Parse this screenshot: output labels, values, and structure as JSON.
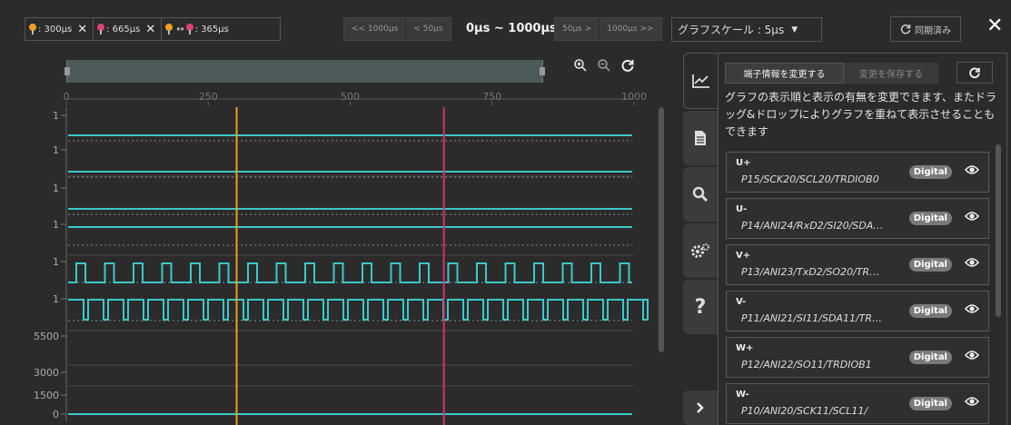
{
  "toolbar": {
    "cursors": [
      {
        "color": "#f0a020",
        "label": ": 300µs",
        "removable": true
      },
      {
        "color": "#e0407a",
        "label": ": 665µs",
        "removable": true
      }
    ],
    "delta": {
      "label": ": 365µs",
      "arrow": "↔"
    },
    "close_cursor_symbol": "✕",
    "nav_left": [
      "<< 1000µs",
      "< 50µs"
    ],
    "range_label": "0µs ~ 1000µs",
    "nav_right": [
      "50µs >",
      "1000µs >>"
    ],
    "scale_label": "グラフスケール : 5µs",
    "scale_caret": "▼",
    "sync_label": "同期済み",
    "close_symbol": "✕"
  },
  "plot": {
    "x_ticks": [
      "0",
      "250",
      "500",
      "750",
      "1000"
    ],
    "y_labels": [
      "1",
      "1",
      "1",
      "1",
      "1",
      "1",
      "5500",
      "3000",
      "1500",
      "0"
    ],
    "cursor_positions_us": [
      300,
      665
    ],
    "x_range_us": [
      0,
      1000
    ],
    "colors": {
      "signal": "#3cc8c8",
      "cursor1": "#e8a020",
      "cursor2": "#d8306a"
    }
  },
  "side_tabs": [
    "chart-icon",
    "document-icon",
    "search-icon",
    "settings-icon",
    "help-icon",
    "chevron-right-icon"
  ],
  "panel": {
    "tab_change": "端子情報を変更する",
    "tab_save": "変更を保存する",
    "description": "グラフの表示順と表示の有無を変更できます、またドラッグ&ドロップによりグラフを重ねて表示させることもできます",
    "pins": [
      {
        "name": "U+",
        "func": "P15/SCK20/SCL20/TRDIOB0",
        "badge": "Digital"
      },
      {
        "name": "U-",
        "func": "P14/ANI24/RxD2/SI20/SDA…",
        "badge": "Digital"
      },
      {
        "name": "V+",
        "func": "P13/ANI23/TxD2/SO20/TR…",
        "badge": "Digital"
      },
      {
        "name": "V-",
        "func": "P11/ANI21/SI11/SDA11/TR…",
        "badge": "Digital"
      },
      {
        "name": "W+",
        "func": "P12/ANI22/SO11/TRDIOB1",
        "badge": "Digital"
      },
      {
        "name": "W-",
        "func": "P10/ANI20/SCK11/SCL11/",
        "badge": "Digital"
      }
    ]
  }
}
